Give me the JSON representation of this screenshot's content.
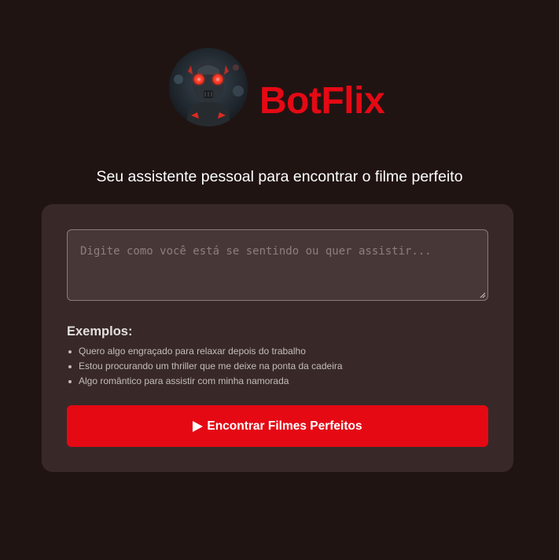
{
  "header": {
    "brand": "BotFlix",
    "avatar_icon": "robot-avatar-icon"
  },
  "subtitle": "Seu assistente pessoal para encontrar o filme perfeito",
  "search": {
    "placeholder": "Digite como você está se sentindo ou quer assistir...",
    "value": ""
  },
  "examples": {
    "title": "Exemplos:",
    "items": [
      "Quero algo engraçado para relaxar depois do trabalho",
      "Estou procurando um thriller que me deixe na ponta da cadeira",
      "Algo romântico para assistir com minha namorada"
    ]
  },
  "cta": {
    "icon": "play-icon",
    "label": "Encontrar Filmes Perfeitos"
  },
  "colors": {
    "background": "#201413",
    "card": "#382928",
    "accent": "#e50914",
    "input_bg": "#473837"
  }
}
